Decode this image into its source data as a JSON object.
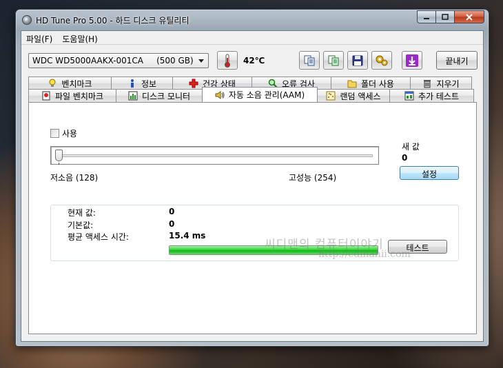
{
  "window": {
    "title": "HD Tune Pro 5.00 - 하드 디스크 유틸리티"
  },
  "menu": {
    "file": "파일(F)",
    "help": "도움말(H)"
  },
  "toolbar": {
    "drive": "WDC WD5000AAKX-001CA     (500 GB)",
    "temperature": "42℃",
    "exit": "끝내기"
  },
  "tabs": {
    "back_row": [
      {
        "label": "벤치마크",
        "icon": "lightbulb-icon"
      },
      {
        "label": "정보",
        "icon": "info-icon"
      },
      {
        "label": "건강 상태",
        "icon": "red-cross-icon"
      },
      {
        "label": "오류 검사",
        "icon": "magnifier-icon"
      },
      {
        "label": "폴더 사용",
        "icon": "folder-icon"
      },
      {
        "label": "지우기",
        "icon": "trash-icon"
      }
    ],
    "front_row": [
      {
        "label": "파일 벤치마크",
        "icon": "file-benchmark-icon"
      },
      {
        "label": "디스크 모니터",
        "icon": "disk-monitor-icon"
      },
      {
        "label": "자동 소음 관리(AAM)",
        "icon": "speaker-icon",
        "active": true
      },
      {
        "label": "랜덤 액세스",
        "icon": "random-access-icon"
      },
      {
        "label": "추가 테스트",
        "icon": "extra-tests-icon"
      }
    ]
  },
  "aam": {
    "enable_label": "사용",
    "enabled": false,
    "slider_value": 0,
    "low_label": "저소음 (128)",
    "high_label": "고성능 (254)",
    "new_value_label": "새 값",
    "new_value": "0",
    "set_button": "설정",
    "current_label": "현재 값:",
    "current_value": "0",
    "default_label": "기본값:",
    "default_value": "0",
    "access_label": "평균 액세스 시간:",
    "access_value": "15.4 ms",
    "progress_percent": 100,
    "test_button": "테스트"
  },
  "watermark": {
    "line1": "씨디맨의 컴퓨터이야기",
    "line2": "http://cdmanii.com"
  },
  "colors": {
    "progress": "#22c428",
    "accent_button": "#bee6fd"
  }
}
